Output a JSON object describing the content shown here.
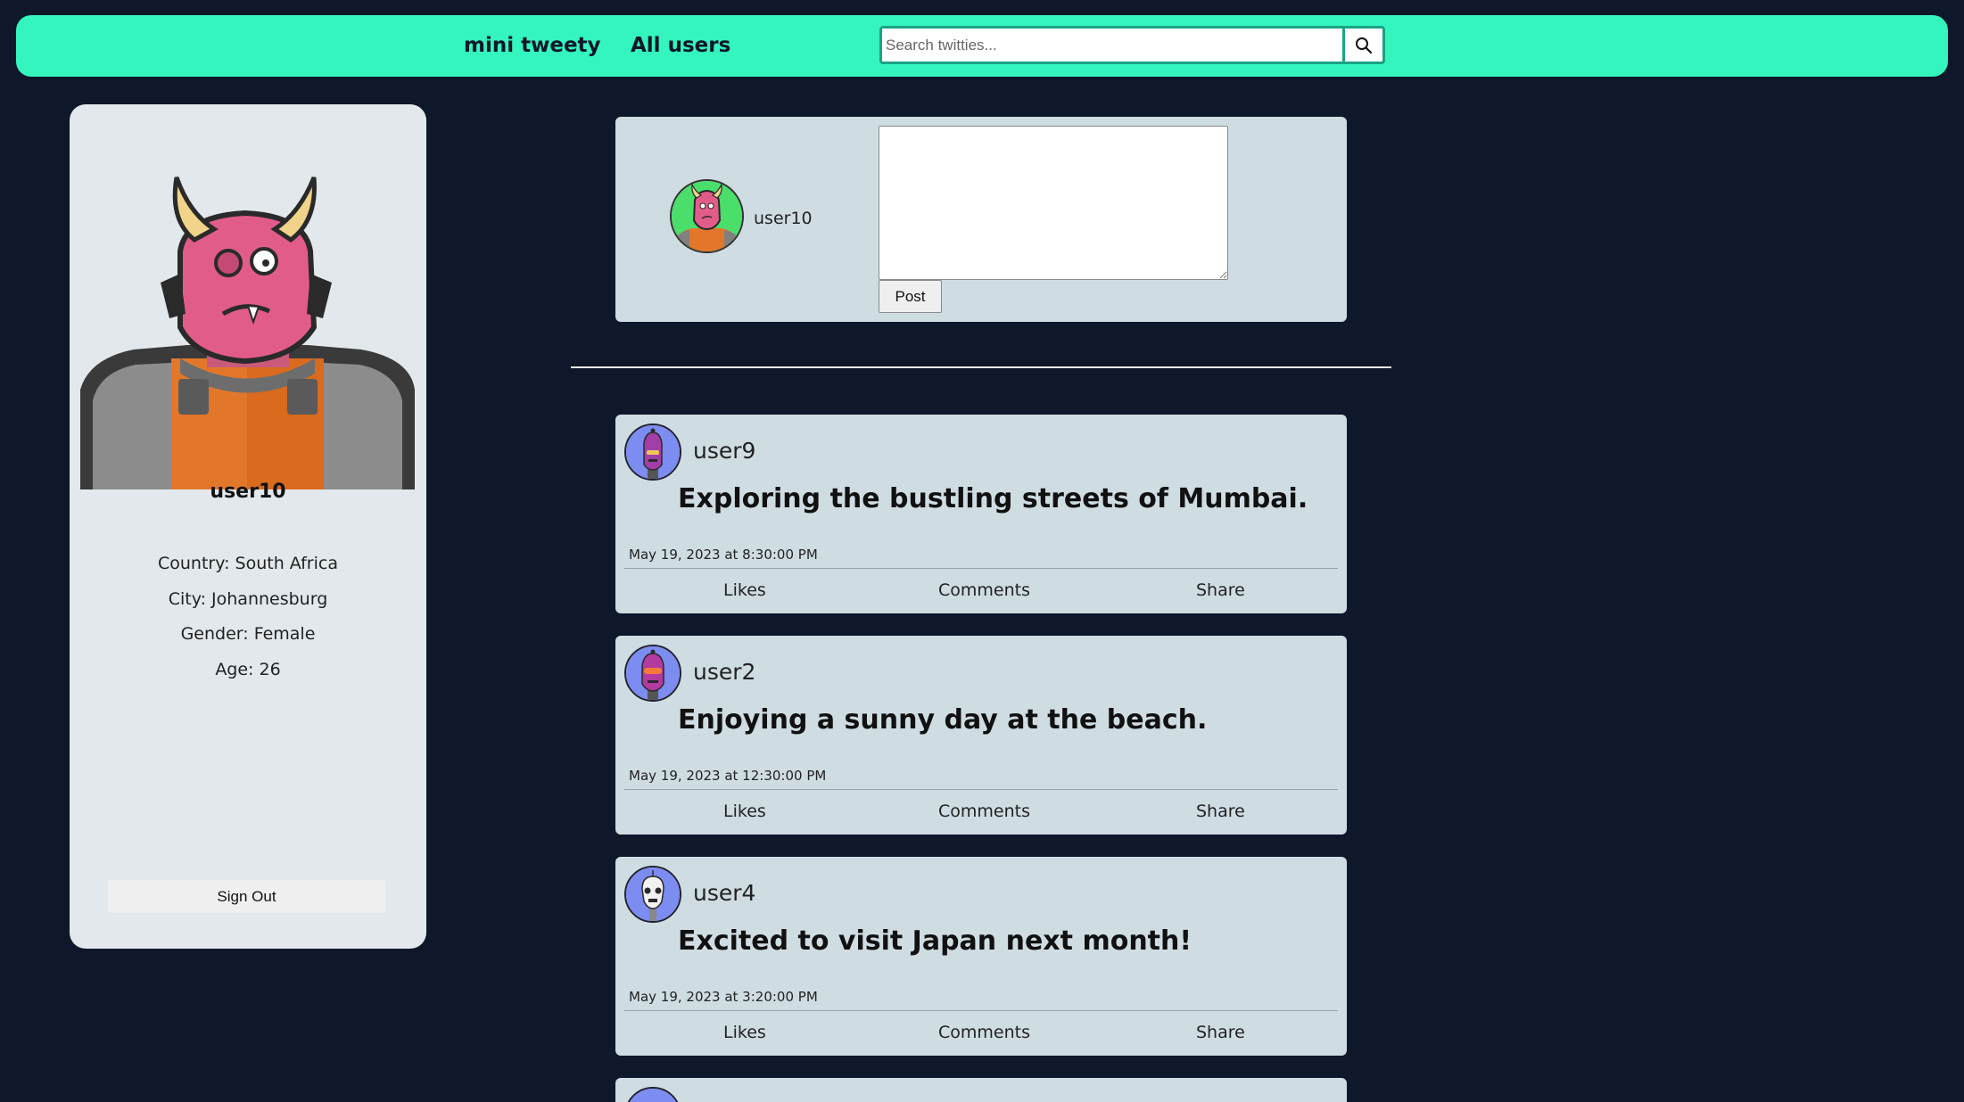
{
  "nav": {
    "brand": "mini tweety",
    "all_users": "All users",
    "search_placeholder": "Search twitties..."
  },
  "profile": {
    "username": "user10",
    "country": "Country: South Africa",
    "city": "City: Johannesburg",
    "gender": "Gender: Female",
    "age": "Age: 26",
    "sign_out": "Sign Out"
  },
  "composer": {
    "username": "user10",
    "text_value": "",
    "post_label": "Post"
  },
  "tweets": [
    {
      "username": "user9",
      "text": "Exploring the bustling streets of Mumbai.",
      "time": "May 19, 2023 at 8:30:00 PM",
      "likes": "Likes",
      "comments": "Comments",
      "share": "Share"
    },
    {
      "username": "user2",
      "text": "Enjoying a sunny day at the beach.",
      "time": "May 19, 2023 at 12:30:00 PM",
      "likes": "Likes",
      "comments": "Comments",
      "share": "Share"
    },
    {
      "username": "user4",
      "text": "Excited to visit Japan next month!",
      "time": "May 19, 2023 at 3:20:00 PM",
      "likes": "Likes",
      "comments": "Comments",
      "share": "Share"
    }
  ],
  "colors": {
    "background": "#0f172a",
    "navbar": "#34f5bd",
    "card": "#e2e8ec",
    "tweet_card": "#cfdde3",
    "composer_avatar_bg": "#4ade6b",
    "tweet_avatar_bg": "#7c8cf0"
  },
  "icons": {
    "search": "search-icon",
    "profile_avatar": "demon-robot-avatar",
    "user9_avatar": "purple-robot-avatar",
    "user2_avatar": "purple-robot-avatar",
    "user4_avatar": "skull-robot-avatar"
  }
}
